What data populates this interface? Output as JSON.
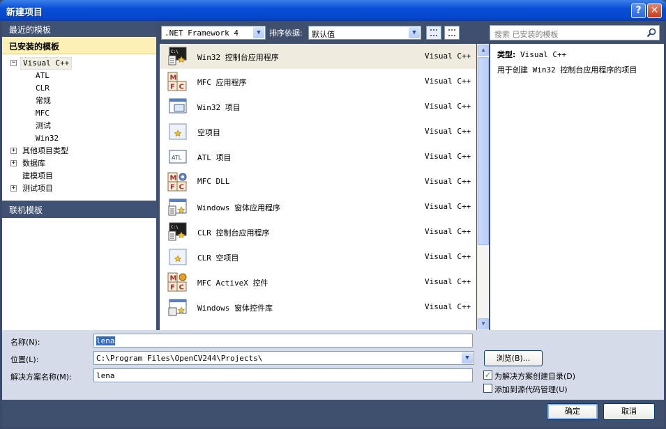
{
  "window": {
    "title": "新建项目",
    "help_glyph": "?",
    "close_glyph": "✕"
  },
  "left": {
    "recent_label": "最近的模板",
    "installed_label": "已安装的模板",
    "online_label": "联机模板",
    "tree": [
      {
        "label": "Visual C++",
        "expander": "−",
        "selected": true,
        "children": [
          "ATL",
          "CLR",
          "常规",
          "MFC",
          "测试",
          "Win32"
        ]
      },
      {
        "label": "其他项目类型",
        "expander": "+"
      },
      {
        "label": "数据库",
        "expander": "+"
      },
      {
        "label": "建模项目",
        "expander": ""
      },
      {
        "label": "测试项目",
        "expander": "+"
      }
    ]
  },
  "toolbar": {
    "framework": ".NET Framework 4",
    "sort_label": "排序依据:",
    "sort_value": "默认值"
  },
  "search": {
    "placeholder": "搜索 已安装的模板"
  },
  "templates": [
    {
      "name": "Win32 控制台应用程序",
      "lang": "Visual C++",
      "icon": "console-app-icon",
      "selected": true
    },
    {
      "name": "MFC 应用程序",
      "lang": "Visual C++",
      "icon": "mfc-app-icon"
    },
    {
      "name": "Win32 项目",
      "lang": "Visual C++",
      "icon": "win32-project-icon"
    },
    {
      "name": "空项目",
      "lang": "Visual C++",
      "icon": "empty-project-icon"
    },
    {
      "name": "ATL 项目",
      "lang": "Visual C++",
      "icon": "atl-project-icon"
    },
    {
      "name": "MFC DLL",
      "lang": "Visual C++",
      "icon": "mfc-dll-icon"
    },
    {
      "name": "Windows 窗体应用程序",
      "lang": "Visual C++",
      "icon": "windows-forms-app-icon"
    },
    {
      "name": "CLR 控制台应用程序",
      "lang": "Visual C++",
      "icon": "console-app-icon"
    },
    {
      "name": "CLR 空项目",
      "lang": "Visual C++",
      "icon": "empty-project-icon"
    },
    {
      "name": "MFC ActiveX 控件",
      "lang": "Visual C++",
      "icon": "mfc-activex-icon"
    },
    {
      "name": "Windows 窗体控件库",
      "lang": "Visual C++",
      "icon": "forms-control-library-icon"
    }
  ],
  "details": {
    "type_label": "类型:",
    "type_value": "Visual C++",
    "description": "用于创建 Win32 控制台应用程序的项目"
  },
  "form": {
    "name_label": "名称(N):",
    "name_value": "lena",
    "location_label": "位置(L):",
    "location_value": "C:\\Program Files\\OpenCV244\\Projects\\",
    "solution_label": "解决方案名称(M):",
    "solution_value": "lena",
    "browse_label": "浏览(B)...",
    "create_dir_label": "为解决方案创建目录(D)",
    "create_dir_checked": true,
    "source_control_label": "添加到源代码管理(U)",
    "source_control_checked": false
  },
  "buttons": {
    "ok": "确定",
    "cancel": "取消"
  }
}
